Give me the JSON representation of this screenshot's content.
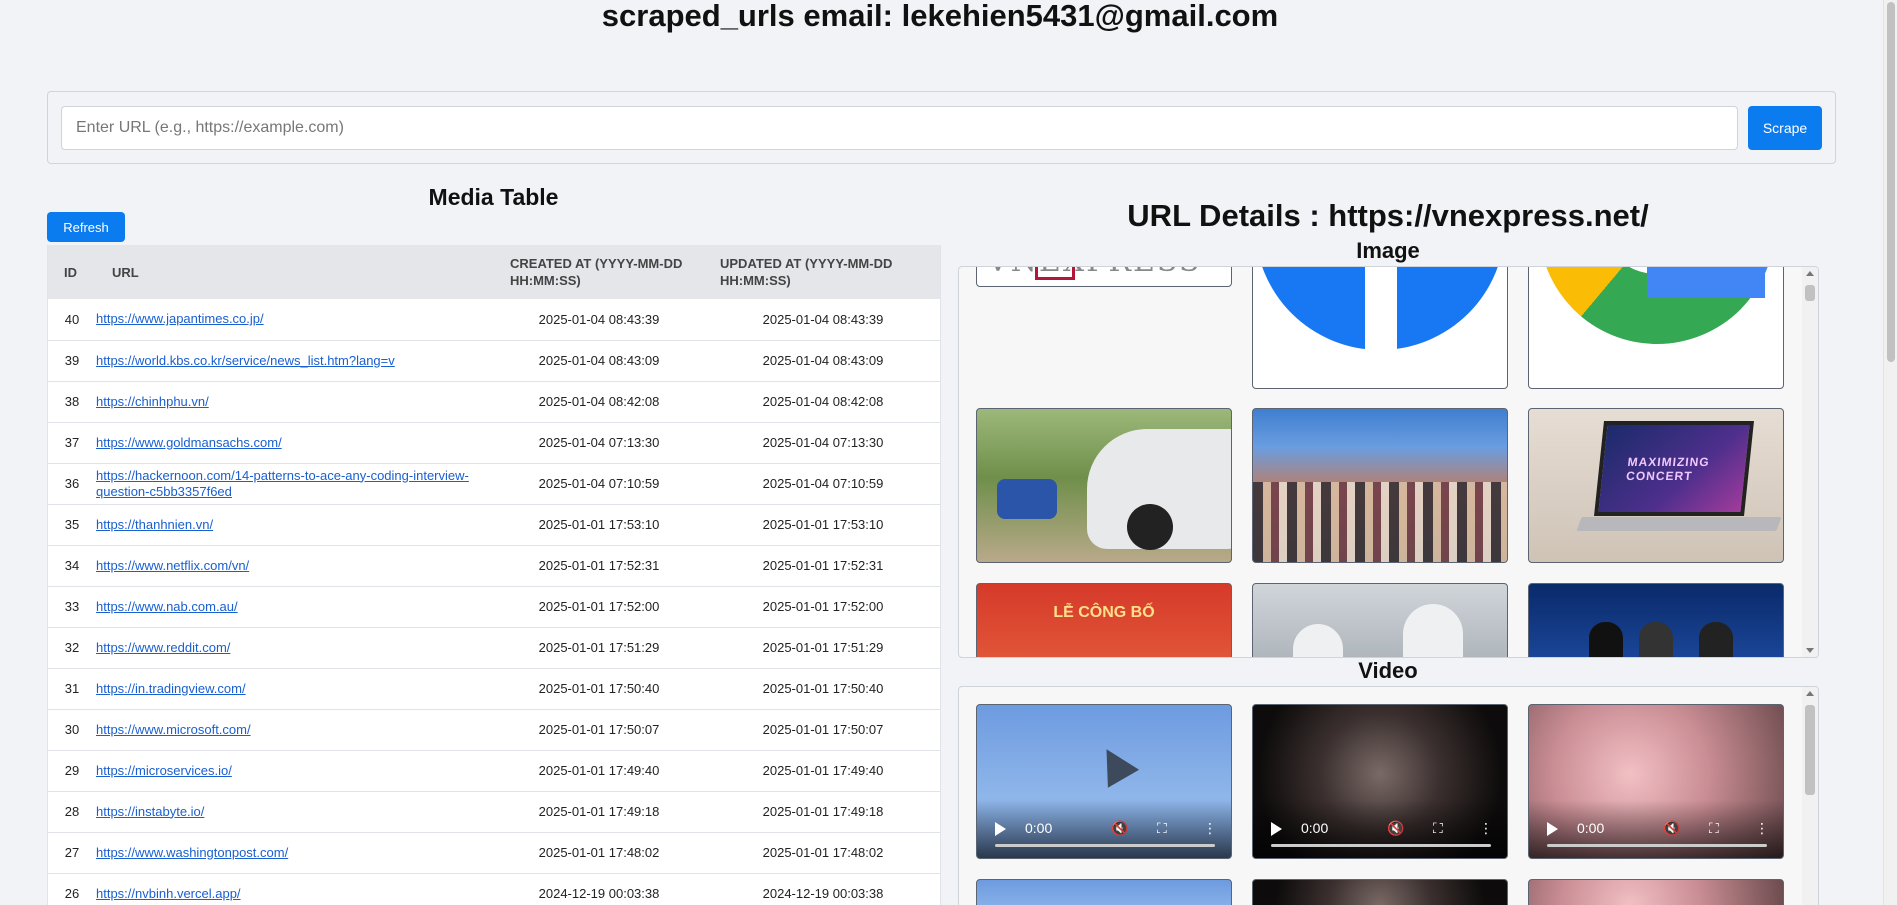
{
  "page": {
    "title": "scraped_urls email: lekehien5431@gmail.com"
  },
  "scrape": {
    "placeholder": "Enter URL (e.g., https://example.com)",
    "button_label": "Scrape"
  },
  "media_table": {
    "title": "Media Table",
    "refresh_label": "Refresh",
    "columns": [
      "ID",
      "URL",
      "CREATED AT (YYYY-MM-DD HH:MM:SS)",
      "UPDATED AT (YYYY-MM-DD HH:MM:SS)"
    ],
    "rows": [
      {
        "id": "40",
        "url": "https://www.japantimes.co.jp/",
        "created": "2025-01-04 08:43:39",
        "updated": "2025-01-04 08:43:39"
      },
      {
        "id": "39",
        "url": "https://world.kbs.co.kr/service/news_list.htm?lang=v",
        "created": "2025-01-04 08:43:09",
        "updated": "2025-01-04 08:43:09"
      },
      {
        "id": "38",
        "url": "https://chinhphu.vn/",
        "created": "2025-01-04 08:42:08",
        "updated": "2025-01-04 08:42:08"
      },
      {
        "id": "37",
        "url": "https://www.goldmansachs.com/",
        "created": "2025-01-04 07:13:30",
        "updated": "2025-01-04 07:13:30"
      },
      {
        "id": "36",
        "url": "https://hackernoon.com/14-patterns-to-ace-any-coding-interview-question-c5bb3357f6ed",
        "created": "2025-01-04 07:10:59",
        "updated": "2025-01-04 07:10:59"
      },
      {
        "id": "35",
        "url": "https://thanhnien.vn/",
        "created": "2025-01-01 17:53:10",
        "updated": "2025-01-01 17:53:10"
      },
      {
        "id": "34",
        "url": "https://www.netflix.com/vn/",
        "created": "2025-01-01 17:52:31",
        "updated": "2025-01-01 17:52:31"
      },
      {
        "id": "33",
        "url": "https://www.nab.com.au/",
        "created": "2025-01-01 17:52:00",
        "updated": "2025-01-01 17:52:00"
      },
      {
        "id": "32",
        "url": "https://www.reddit.com/",
        "created": "2025-01-01 17:51:29",
        "updated": "2025-01-01 17:51:29"
      },
      {
        "id": "31",
        "url": "https://in.tradingview.com/",
        "created": "2025-01-01 17:50:40",
        "updated": "2025-01-01 17:50:40"
      },
      {
        "id": "30",
        "url": "https://www.microsoft.com/",
        "created": "2025-01-01 17:50:07",
        "updated": "2025-01-01 17:50:07"
      },
      {
        "id": "29",
        "url": "https://microservices.io/",
        "created": "2025-01-01 17:49:40",
        "updated": "2025-01-01 17:49:40"
      },
      {
        "id": "28",
        "url": "https://instabyte.io/",
        "created": "2025-01-01 17:49:18",
        "updated": "2025-01-01 17:49:18"
      },
      {
        "id": "27",
        "url": "https://www.washingtonpost.com/",
        "created": "2025-01-01 17:48:02",
        "updated": "2025-01-01 17:48:02"
      },
      {
        "id": "26",
        "url": "https://nvbinh.vercel.app/",
        "created": "2024-12-19 00:03:38",
        "updated": "2024-12-19 00:03:38"
      }
    ]
  },
  "details": {
    "title": "URL Details : https://vnexpress.net/",
    "image_label": "Image",
    "video_label": "Video",
    "images": [
      {
        "name": "vnexpress-logo-image"
      },
      {
        "name": "facebook-logo-image"
      },
      {
        "name": "google-logo-image"
      },
      {
        "name": "electric-car-photo"
      },
      {
        "name": "supermarket-crowd-photo"
      },
      {
        "name": "laptop-concert-photo"
      },
      {
        "name": "announcement-banner-photo",
        "text": "LỄ CÔNG BỐ"
      },
      {
        "name": "laboratory-photo"
      },
      {
        "name": "conference-stage-photo"
      }
    ],
    "image_captions": {
      "logo": "VNEXPRESS",
      "concert": "MAXIMIZING CONCERT",
      "banner": "LỄ CÔNG BỐ"
    },
    "videos": [
      {
        "time": "0:00"
      },
      {
        "time": "0:00"
      },
      {
        "time": "0:00"
      }
    ]
  },
  "colors": {
    "accent": "#0b7bf0",
    "link": "#1a5fd0",
    "background": "#f2f3f7"
  }
}
